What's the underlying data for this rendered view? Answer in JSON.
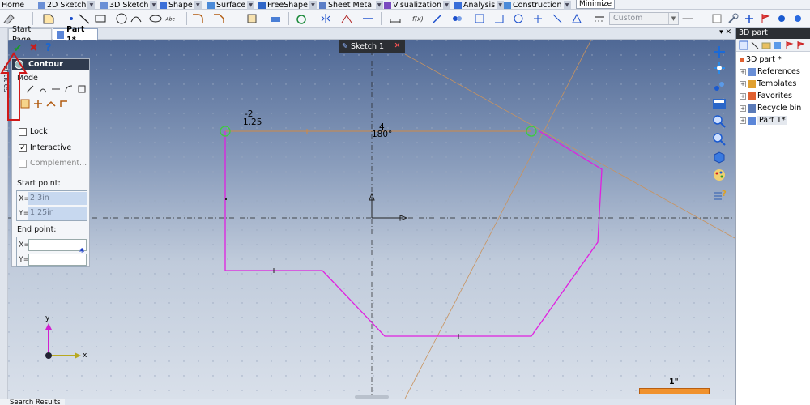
{
  "ribbon": {
    "tabs": [
      "Home",
      "2D Sketch",
      "3D Sketch",
      "Shape",
      "Surface",
      "FreeShape",
      "Sheet Metal",
      "Visualization",
      "Analysis",
      "Construction"
    ],
    "minimize_tooltip": "Minimize"
  },
  "toolbar": {
    "style_select_value": "Custom"
  },
  "left_strip": {
    "label": "Entities"
  },
  "document_tabs": {
    "start": "Start Page",
    "part": "Part 1*"
  },
  "sketch_tab": {
    "label": "Sketch 1"
  },
  "contour_panel": {
    "title": "Contour",
    "mode_label": "Mode",
    "lock_label": "Lock",
    "lock_checked": false,
    "interactive_label": "Interactive",
    "interactive_checked": true,
    "complement_label": "Complement...",
    "start_point_label": "Start point:",
    "start_x_label": "X=",
    "start_x": "2.3in",
    "start_y_label": "Y=",
    "start_y": "1.25in",
    "end_point_label": "End point:",
    "end_x_label": "X=",
    "end_x": "",
    "end_y_label": "Y=",
    "end_y": "",
    "asterisk": "*"
  },
  "canvas": {
    "dim_top_left_1": "-2",
    "dim_top_left_2": "1.25",
    "dim_center_1": "4",
    "dim_center_2": "180°",
    "axis_y": "y",
    "axis_x": "x",
    "scale_label": "1\""
  },
  "colors": {
    "sketch_line": "#e020e0",
    "construction_line": "#d08a45",
    "endpoint_marker": "#3dcc3d",
    "scale_bar": "#f0922e"
  },
  "right_panel": {
    "title": "3D part",
    "tree": [
      "3D part *",
      "References",
      "Templates",
      "Favorites",
      "Recycle bin",
      "Part 1*"
    ]
  },
  "bottom": {
    "tab": "Search Results"
  }
}
